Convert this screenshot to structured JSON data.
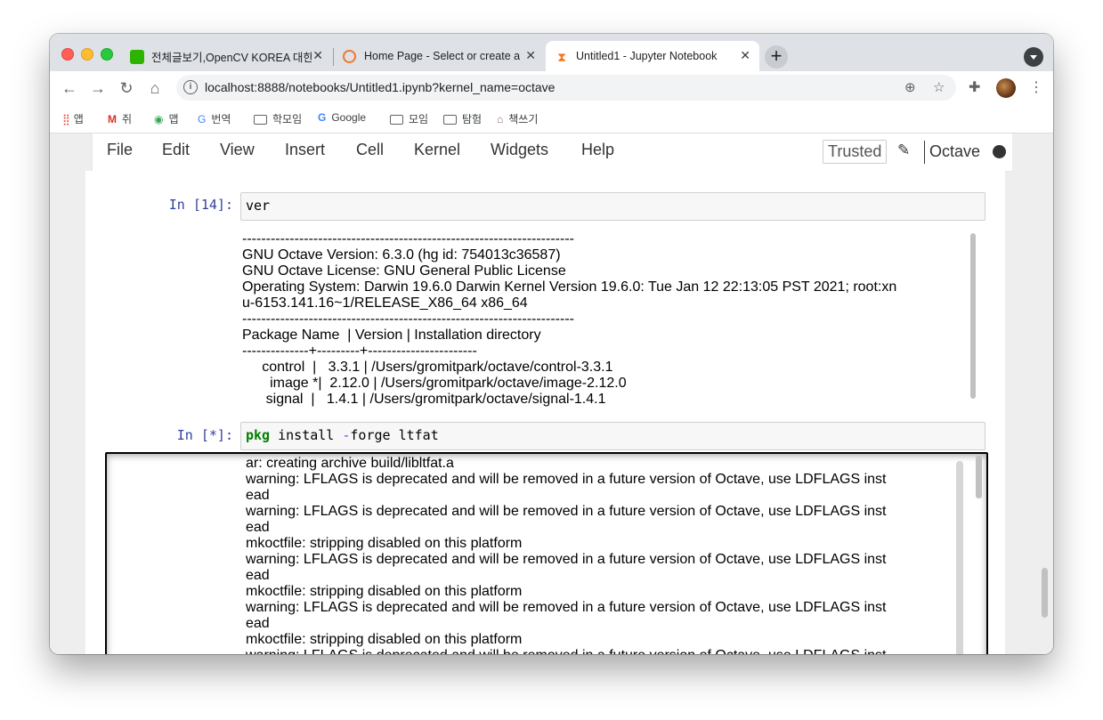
{
  "browser": {
    "tabs": [
      {
        "title": "전체글보기,OpenCV KOREA 대한민국",
        "close": "✕"
      },
      {
        "title": "Home Page - Select or create a notebook",
        "close": "✕"
      },
      {
        "title": "Untitled1 - Jupyter Notebook",
        "close": "✕"
      }
    ],
    "new_tab": "+",
    "url": "localhost:8888/notebooks/Untitled1.ipynb?kernel_name=octave",
    "bookmarks": [
      "앱",
      "쥐",
      "맵",
      "번역",
      "학모임",
      "Google",
      "모임",
      "탐험",
      "책쓰기"
    ]
  },
  "jupyter": {
    "menu": [
      "File",
      "Edit",
      "View",
      "Insert",
      "Cell",
      "Kernel",
      "Widgets",
      "Help"
    ],
    "trusted": "Trusted",
    "kernel": "Octave",
    "cells": [
      {
        "prompt": "In [14]:",
        "code": "ver",
        "output": "----------------------------------------------------------------------\nGNU Octave Version: 6.3.0 (hg id: 754013c36587)\nGNU Octave License: GNU General Public License\nOperating System: Darwin 19.6.0 Darwin Kernel Version 19.6.0: Tue Jan 12 22:13:05 PST 2021; root:xn\nu-6153.141.16~1/RELEASE_X86_64 x86_64\n----------------------------------------------------------------------\nPackage Name  | Version | Installation directory\n--------------+---------+-----------------------\n     control  |   3.3.1 | /Users/gromitpark/octave/control-3.3.1\n       image *|  2.12.0 | /Users/gromitpark/octave/image-2.12.0\n      signal  |   1.4.1 | /Users/gromitpark/octave/signal-1.4.1"
      },
      {
        "prompt": "In [*]:",
        "code_kw": "pkg",
        "code_mid": " install ",
        "code_op": "-",
        "code_rest": "forge ltfat",
        "output": "ar: creating archive build/libltfat.a\nwarning: LFLAGS is deprecated and will be removed in a future version of Octave, use LDFLAGS inst\nead\nwarning: LFLAGS is deprecated and will be removed in a future version of Octave, use LDFLAGS inst\nead\nmkoctfile: stripping disabled on this platform\nwarning: LFLAGS is deprecated and will be removed in a future version of Octave, use LDFLAGS inst\nead\nmkoctfile: stripping disabled on this platform\nwarning: LFLAGS is deprecated and will be removed in a future version of Octave, use LDFLAGS inst\nead\nmkoctfile: stripping disabled on this platform\nwarning: LFLAGS is deprecated and will be removed in a future version of Octave, use LDFLAGS inst"
      }
    ]
  },
  "colors": {
    "prompt": "#303f9f",
    "keyword": "#008000",
    "operator": "#aa22ff"
  }
}
